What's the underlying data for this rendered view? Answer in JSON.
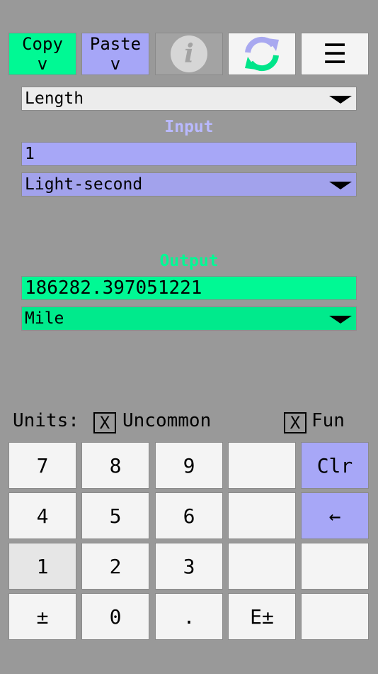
{
  "toolbar": {
    "copy_label": "Copy\nv",
    "paste_label": "Paste\nv",
    "info_icon": "info-icon",
    "swap_icon": "swap-refresh-icon",
    "menu_icon": "menu-icon",
    "menu_glyph": "☰"
  },
  "category": {
    "selected": "Length"
  },
  "input": {
    "heading": "Input",
    "value": "1",
    "unit": "Light-second"
  },
  "output": {
    "heading": "Output",
    "value": "186282.397051221",
    "unit": "Mile"
  },
  "units": {
    "label": "Units:",
    "uncommon": {
      "mark": "X",
      "label": "Uncommon",
      "checked": true
    },
    "fun": {
      "mark": "X",
      "label": "Fun",
      "checked": true
    }
  },
  "keypad": {
    "k7": "7",
    "k8": "8",
    "k9": "9",
    "clr": "Clr",
    "k4": "4",
    "k5": "5",
    "k6": "6",
    "back": "←",
    "k1": "1",
    "k2": "2",
    "k3": "3",
    "sign": "±",
    "k0": "0",
    "dot": ".",
    "exp": "E±"
  },
  "colors": {
    "background": "#999999",
    "output_accent": "#00f994",
    "input_accent": "#a7a7f7",
    "swap_blue": "#a8a8f0",
    "swap_green": "#00e58a"
  }
}
